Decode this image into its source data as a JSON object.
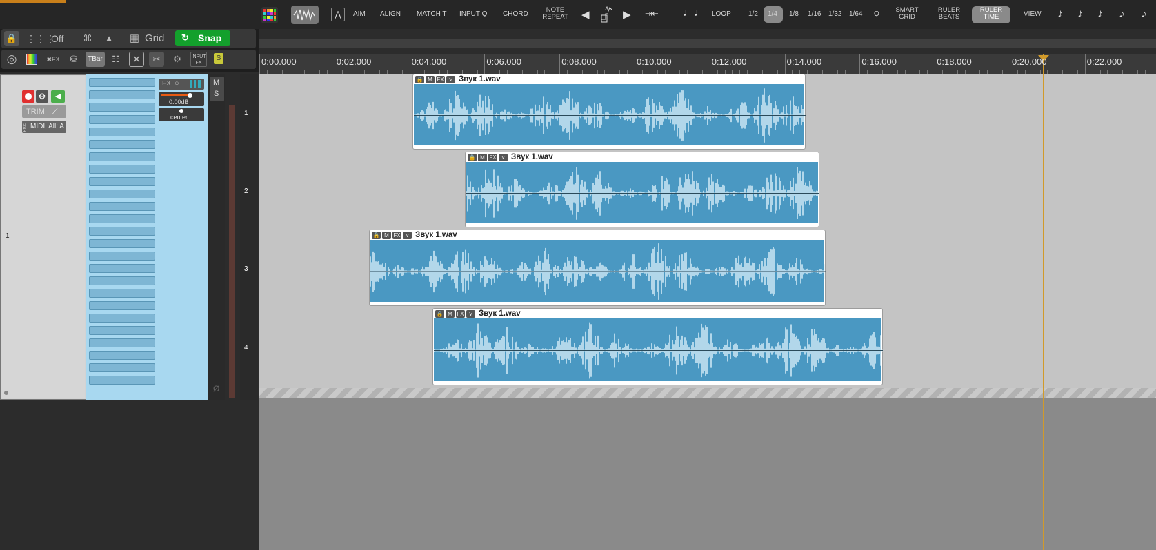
{
  "toolbar": {
    "aim": "AIM",
    "align": "ALIGN",
    "match_t": "MATCH T",
    "input_q": "INPUT Q",
    "chord": "CHORD",
    "note_repeat_1": "NOTE",
    "note_repeat_2": "REPEAT",
    "loop": "LOOP",
    "div_half": "1/2",
    "div_quarter": "1/4",
    "div_eighth": "1/8",
    "div_16": "1/16",
    "div_32": "1/32",
    "div_64": "1/64",
    "q": "Q",
    "smart_grid_1": "SMART",
    "smart_grid_2": "GRID",
    "ruler_beats_1": "RULER",
    "ruler_beats_2": "BEATS",
    "ruler_time_1": "RULER",
    "ruler_time_2": "TIME",
    "view": "VIEW"
  },
  "left": {
    "off": "Off",
    "grid": "Grid",
    "snap": "Snap",
    "tbar": "TBar",
    "input_fx_1": "INPUT",
    "input_fx_2": "FX",
    "s_badge": "S"
  },
  "track": {
    "trim": "TRIM",
    "pre": "PRE",
    "midi": "MIDI: All: A",
    "fx": "FX",
    "volume": "0.00dB",
    "pan": "center",
    "m": "M",
    "s": "S",
    "number": "1",
    "phase": "Ø"
  },
  "lanes": [
    "1",
    "2",
    "3",
    "4"
  ],
  "ruler": [
    "0:00.000",
    "0:02.000",
    "0:04.000",
    "0:06.000",
    "0:08.000",
    "0:10.000",
    "0:12.000",
    "0:14.000",
    "0:16.000",
    "0:18.000",
    "0:20.000",
    "0:22.000"
  ],
  "items": [
    {
      "title": "Звук 1.wav"
    },
    {
      "title": "Звук 1.wav"
    },
    {
      "title": "Звук 1.wav"
    },
    {
      "title": "Звук 1.wav"
    }
  ],
  "colors": {
    "snap_green": "#13a02c",
    "item_blue": "#4a98c2",
    "cursor": "#d19a2a",
    "track_light": "#a8d8f0"
  }
}
